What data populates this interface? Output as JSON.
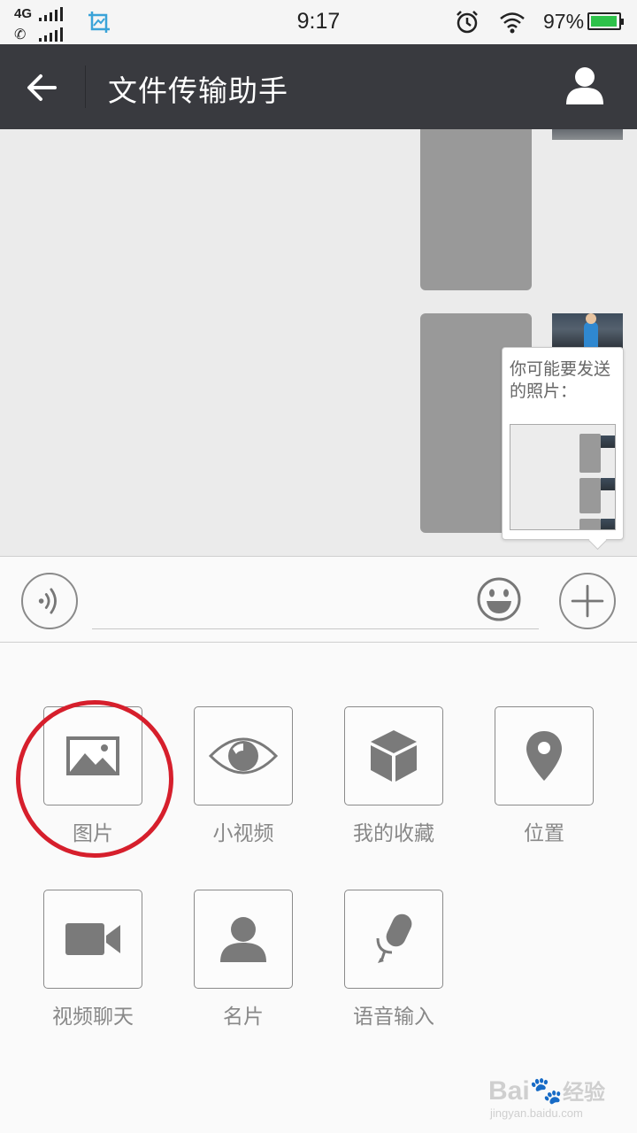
{
  "status_bar": {
    "network": "4G",
    "time": "9:17",
    "battery_percent": "97%",
    "battery_level": 0.97,
    "battery_color": "#2ec24a"
  },
  "nav": {
    "title": "文件传输助手",
    "back_icon": "arrow-left-icon",
    "profile_icon": "user-icon",
    "background": "#393a3f"
  },
  "chat": {
    "suggest_popup": {
      "text": "你可能要发送的照片："
    }
  },
  "input_bar": {
    "voice_icon": "voice-icon",
    "emoji_icon": "smiley-icon",
    "plus_icon": "plus-icon"
  },
  "tools": [
    {
      "label": "图片",
      "icon": "image-icon"
    },
    {
      "label": "小视频",
      "icon": "eye-icon"
    },
    {
      "label": "我的收藏",
      "icon": "cube-icon"
    },
    {
      "label": "位置",
      "icon": "location-pin-icon"
    },
    {
      "label": "视频聊天",
      "icon": "video-camera-icon"
    },
    {
      "label": "名片",
      "icon": "contact-card-icon"
    },
    {
      "label": "语音输入",
      "icon": "microphone-icon"
    }
  ],
  "highlight": {
    "target": "图片",
    "color": "#d61f2c"
  },
  "watermark": {
    "brand": "Bai",
    "brand_cn": "经验",
    "url": "jingyan.baidu.com"
  }
}
